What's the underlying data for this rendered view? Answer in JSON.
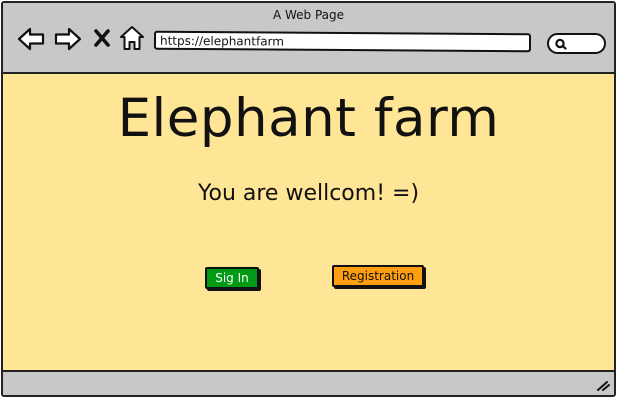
{
  "window": {
    "title": "A Web Page"
  },
  "toolbar": {
    "address_url": "https://elephantfarm",
    "icons": [
      "back-arrow-icon",
      "forward-arrow-icon",
      "close-x-icon",
      "home-icon",
      "search-icon"
    ]
  },
  "main": {
    "headline": "Elephant farm",
    "subheadline": "You are wellcom! =)",
    "buttons": {
      "signin_label": "Sig In",
      "register_label": "Registration"
    }
  },
  "colors": {
    "page_background": "#ffe596",
    "chrome": "#c8c8c8",
    "signin_button": "#009a14",
    "register_button": "#ff9e0f"
  }
}
